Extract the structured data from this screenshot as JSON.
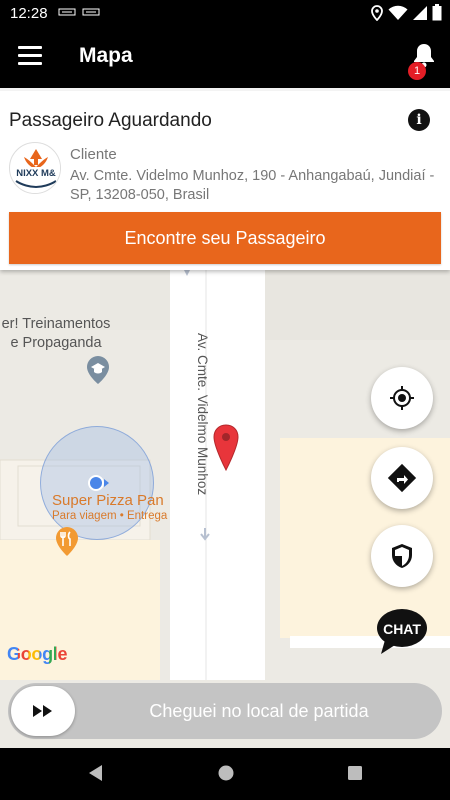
{
  "status_bar": {
    "time": "12:28",
    "icons": [
      "app-notification-icon",
      "app-notification-icon",
      "location-icon",
      "wifi-icon",
      "signal-icon",
      "battery-icon"
    ]
  },
  "app_bar": {
    "title": "Mapa",
    "notification_count": "1"
  },
  "card": {
    "heading": "Passageiro Aguardando",
    "avatar_text": "NIXX M&",
    "role": "Cliente",
    "address": "Av. Cmte. Videlmo Munhoz, 190 - Anhangabaú, Jundiaí - SP, 13208-050, Brasil",
    "cta_label": "Encontre seu Passageiro"
  },
  "map": {
    "street_name": "Av. Cmte. Videlmo Munhoz",
    "poi_training": "er! Treinamentos\ne Propaganda",
    "poi_pizza_name": "Super Pizza Pan",
    "poi_pizza_sub": "Para viagem • Entrega",
    "attribution": "Google",
    "colors": {
      "road": "#ffffff",
      "land": "#eceae4",
      "block": "#fdf3dd",
      "pin": "#e8353b",
      "location": "#4a86e8"
    }
  },
  "fabs": {
    "my_location": "my-location-icon",
    "directions": "directions-icon",
    "safety": "shield-icon",
    "chat_label": "CHAT"
  },
  "slider": {
    "label": "Cheguei no local de partida"
  },
  "nav_bar": {
    "buttons": [
      "back-icon",
      "home-icon",
      "recents-icon"
    ]
  },
  "theme": {
    "accent": "#e8661c",
    "badge": "#e41e26",
    "bar_bg": "#000000"
  }
}
